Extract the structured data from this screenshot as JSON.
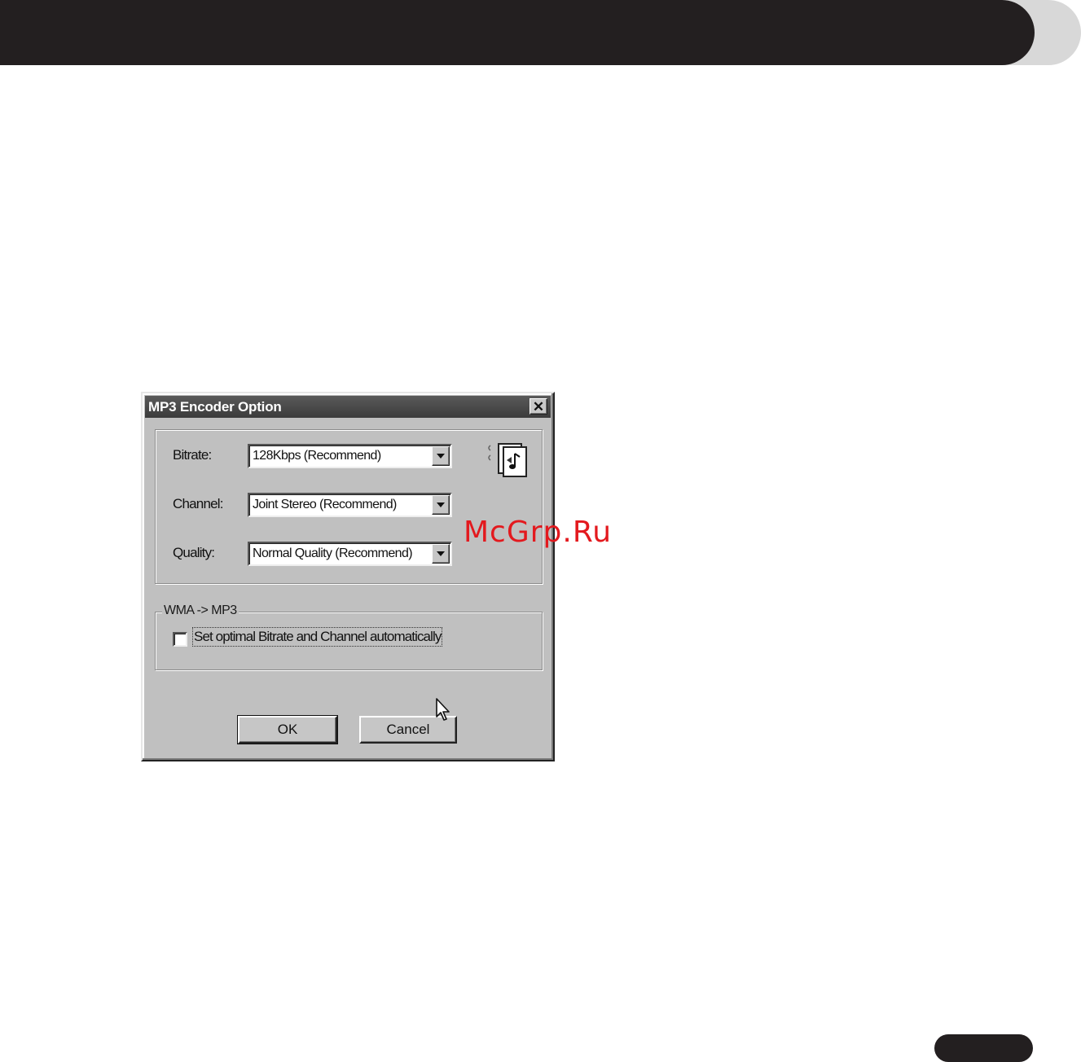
{
  "watermark": "McGrp.Ru",
  "dialog": {
    "title": "MP3 Encoder Option",
    "close_icon": "close-icon",
    "fields": [
      {
        "label": "Bitrate:",
        "value": "128Kbps (Recommend)"
      },
      {
        "label": "Channel:",
        "value": "Joint Stereo (Recommend)"
      },
      {
        "label": "Quality:",
        "value": "Normal Quality (Recommend)"
      }
    ],
    "icon": "music-file-icon",
    "group2_legend": "WMA -> MP3",
    "checkbox": {
      "label": "Set optimal Bitrate and Channel automatically",
      "checked": false
    },
    "ok_label": "OK",
    "cancel_label": "Cancel"
  },
  "colors": {
    "header": "#231f20",
    "dialog_bg": "#c0c0c0",
    "titlebar": "#3b3b3b",
    "watermark": "#e3191e"
  }
}
